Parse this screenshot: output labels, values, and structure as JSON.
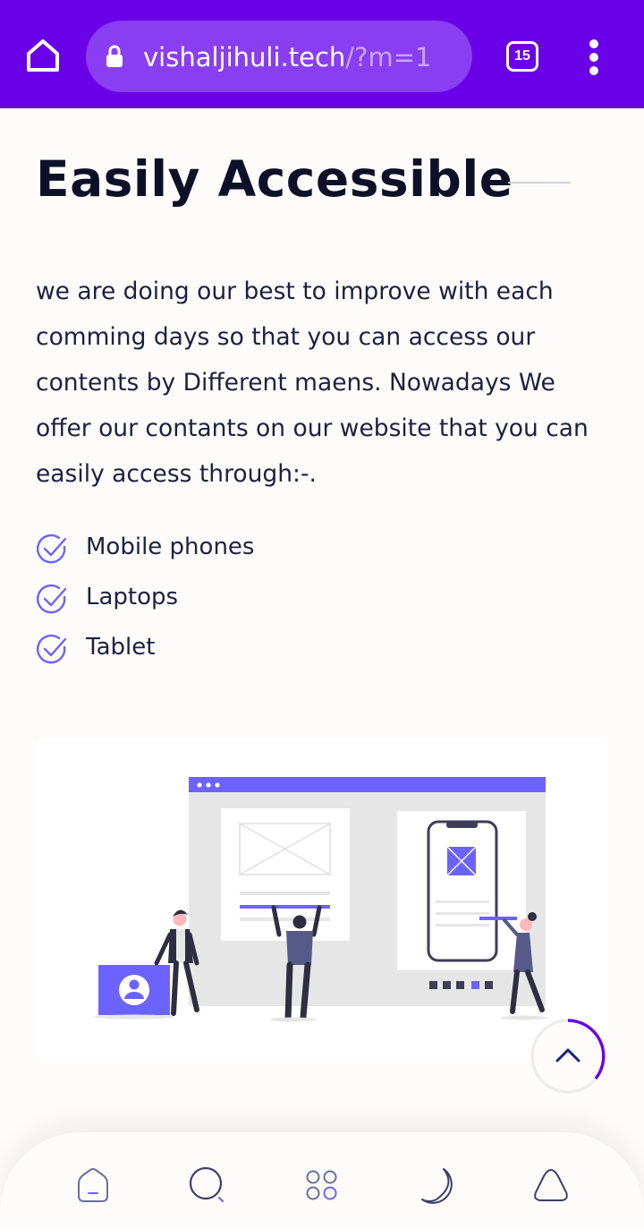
{
  "browser": {
    "url_host": "vishaljihuli.tech",
    "url_path": "/?m=1",
    "tab_count": "15",
    "accent_color": "#6a00e8"
  },
  "section": {
    "title": "Easily Accessible",
    "description": "we are doing our best to improve with each comming days so that you can access our contents by Different maens. Nowadays We offer our contants on our website that you can easily access through:-.",
    "features": [
      {
        "label": "Mobile phones",
        "icon": "check-circle-icon"
      },
      {
        "label": "Laptops",
        "icon": "check-circle-icon"
      },
      {
        "label": "Tablet",
        "icon": "check-circle-icon"
      }
    ]
  },
  "colors": {
    "brand": "#6c63ff",
    "text": "#1d2140",
    "heading": "#0d1128"
  },
  "bottom_nav": {
    "items": [
      {
        "icon": "home-icon"
      },
      {
        "icon": "search-icon"
      },
      {
        "icon": "grid-icon"
      },
      {
        "icon": "moon-icon"
      },
      {
        "icon": "triangle-icon"
      }
    ]
  }
}
